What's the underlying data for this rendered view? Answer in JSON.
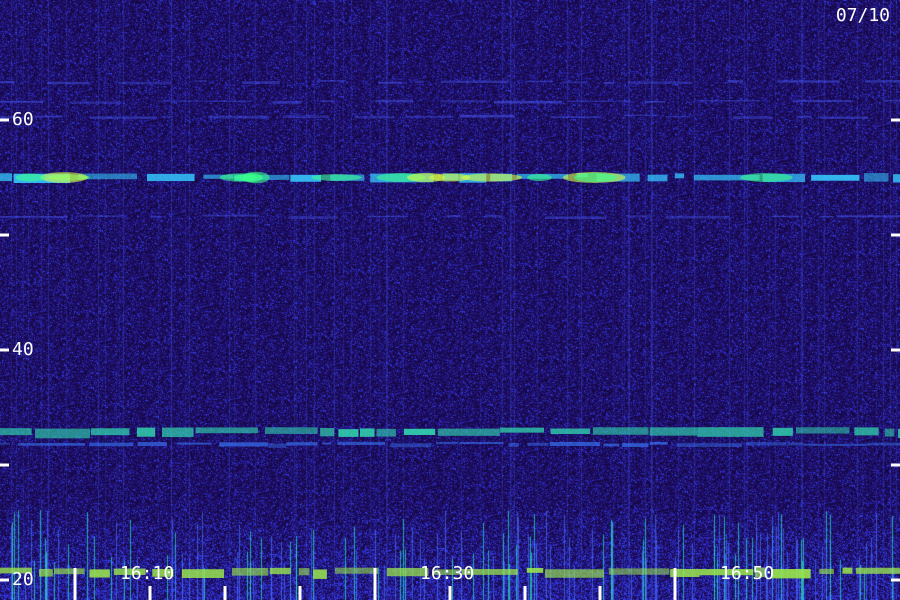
{
  "chart_data": {
    "type": "heatmap",
    "title": "",
    "date_label": "07/10",
    "xlabel": "",
    "ylabel": "",
    "x_ticks": [
      "16:10",
      "16:30",
      "16:50"
    ],
    "y_tick_labels": [
      "60",
      "40",
      "20"
    ],
    "y_range": [
      20,
      60
    ],
    "y_minor_ticks": [
      30,
      50
    ],
    "colormap": [
      "#1a0a4a",
      "#2a1aa8",
      "#3a5aff",
      "#19e6c8",
      "#5cff6a",
      "#ffee33"
    ],
    "bands": [
      {
        "y": 55,
        "intensity": "strong",
        "color": "#36c8ff"
      },
      {
        "y": 60.3,
        "intensity": "weak",
        "color": "#4a5cff"
      },
      {
        "y": 61.6,
        "intensity": "weak",
        "color": "#4a5cff"
      },
      {
        "y": 63.3,
        "intensity": "weak",
        "color": "#4a5cff"
      },
      {
        "y": 51.6,
        "intensity": "weak",
        "color": "#4a5cff"
      },
      {
        "y": 32.9,
        "intensity": "strong",
        "color": "#32d8b0"
      },
      {
        "y": 31.8,
        "intensity": "medium",
        "color": "#3a7cff"
      },
      {
        "y": 20.7,
        "intensity": "strong",
        "color": "#9ce84a"
      }
    ]
  },
  "colors": {
    "background": "#1a0a4a",
    "tick": "#ffffff",
    "text": "#ffffff"
  }
}
